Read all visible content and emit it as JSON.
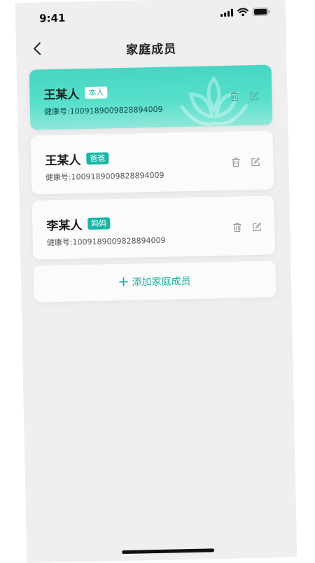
{
  "status_bar": {
    "time": "9:41"
  },
  "nav": {
    "title": "家庭成员",
    "back_icon": "chevron-left-icon"
  },
  "members": [
    {
      "name": "王某人",
      "relation": "本人",
      "health_label": "健康号:",
      "health_id": "1009189009828894009",
      "selected": true
    },
    {
      "name": "王某人",
      "relation": "爸爸",
      "health_label": "健康号:",
      "health_id": "1009189009828894009",
      "selected": false
    },
    {
      "name": "李某人",
      "relation": "妈妈",
      "health_label": "健康号:",
      "health_id": "1009189009828894009",
      "selected": false
    }
  ],
  "add_button": {
    "icon": "plus-icon",
    "label": "添加家庭成员"
  },
  "colors": {
    "accent": "#18b8a8",
    "highlight_card": "#46d6c2",
    "background": "#efefef"
  }
}
